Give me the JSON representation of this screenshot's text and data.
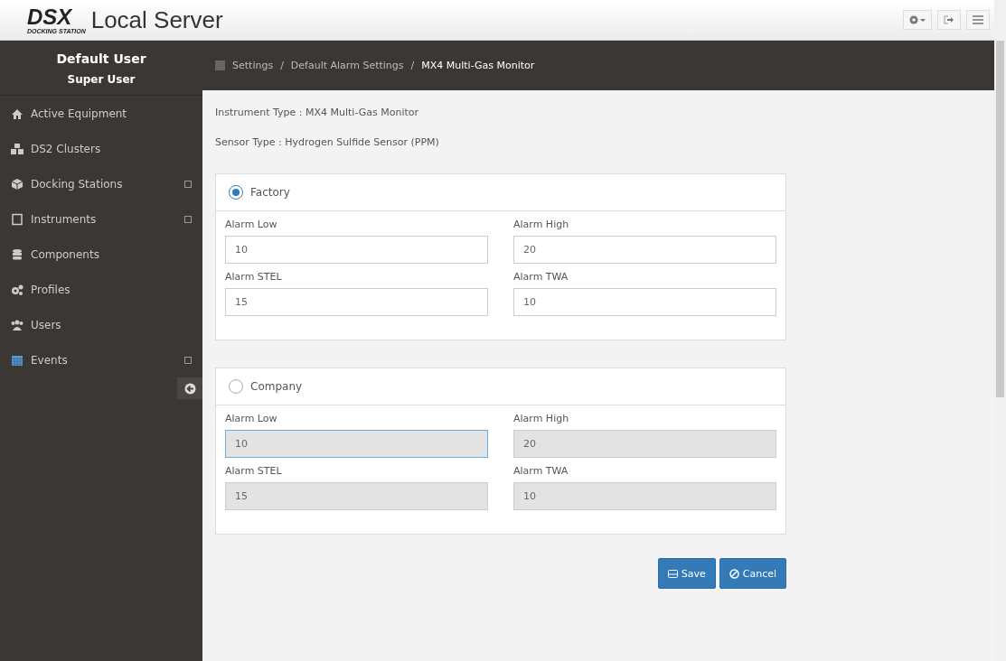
{
  "header": {
    "logo_text": "DSX",
    "logo_subtext": "DOCKING STATION",
    "title": "Local Server"
  },
  "user": {
    "name": "Default User",
    "role": "Super User"
  },
  "sidebar": {
    "items": [
      {
        "label": "Active Equipment",
        "expandable": false
      },
      {
        "label": "DS2 Clusters",
        "expandable": false
      },
      {
        "label": "Docking Stations",
        "expandable": true
      },
      {
        "label": "Instruments",
        "expandable": true
      },
      {
        "label": "Components",
        "expandable": false
      },
      {
        "label": "Profiles",
        "expandable": false
      },
      {
        "label": "Users",
        "expandable": false
      },
      {
        "label": "Events",
        "expandable": true
      }
    ]
  },
  "breadcrumb": [
    {
      "label": "Settings",
      "separator": "/"
    },
    {
      "label": "Default Alarm Settings",
      "separator": "/"
    },
    {
      "label": "MX4 Multi-Gas Monitor"
    }
  ],
  "info": [
    "Instrument Type : MX4 Multi-Gas Monitor",
    "Sensor Type : Hydrogen Sulfide Sensor (PPM)"
  ],
  "sections": [
    {
      "label": "Factory",
      "selected": true,
      "fields": [
        {
          "label": "Alarm Low",
          "value": "10",
          "focused": false
        },
        {
          "label": "Alarm High",
          "value": "20",
          "focused": false
        },
        {
          "label": "Alarm STEL",
          "value": "15",
          "focused": false
        },
        {
          "label": "Alarm TWA",
          "value": "10",
          "focused": false
        }
      ]
    },
    {
      "label": "Company",
      "selected": false,
      "fields": [
        {
          "label": "Alarm Low",
          "value": "10",
          "focused": true
        },
        {
          "label": "Alarm High",
          "value": "20",
          "focused": false
        },
        {
          "label": "Alarm STEL",
          "value": "15",
          "focused": false
        },
        {
          "label": "Alarm TWA",
          "value": "10",
          "focused": false
        }
      ]
    }
  ],
  "buttons": [
    {
      "label": "Save",
      "kind": "save"
    },
    {
      "label": "Cancel",
      "kind": "cancel"
    }
  ]
}
